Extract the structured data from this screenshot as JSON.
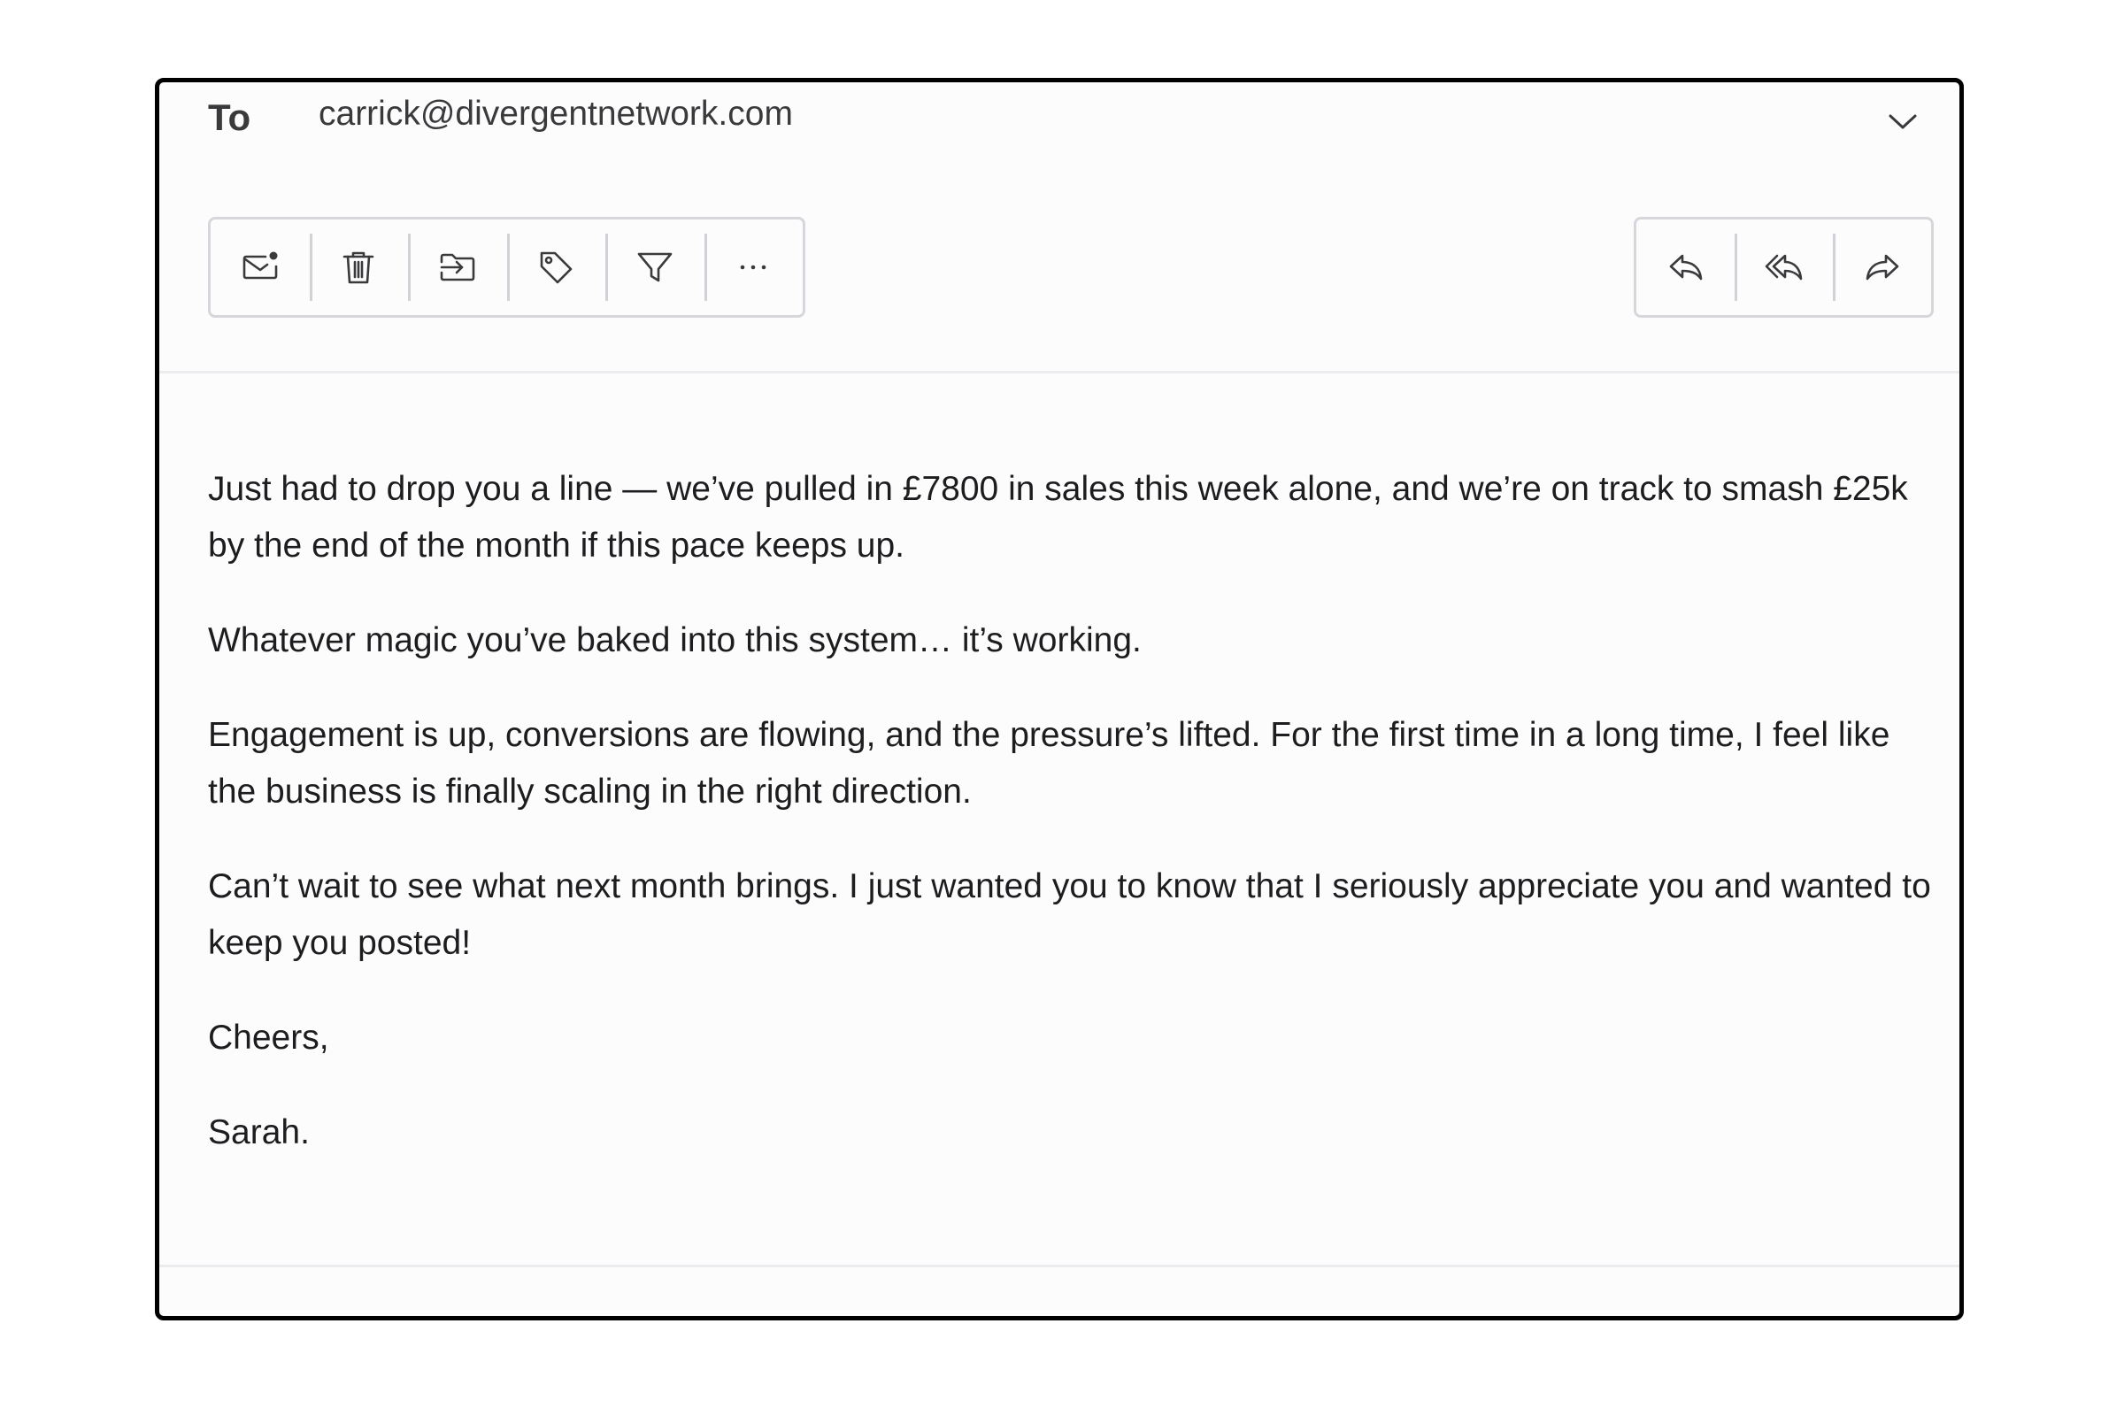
{
  "header": {
    "to_label": "To",
    "to_address": "carrick@divergentnetwork.com",
    "expand_icon": "chevron-down-icon"
  },
  "toolbar": {
    "left_actions": [
      {
        "icon": "mail-unread-icon",
        "label": "Mark as unread"
      },
      {
        "icon": "trash-icon",
        "label": "Delete"
      },
      {
        "icon": "move-to-folder-icon",
        "label": "Move"
      },
      {
        "icon": "tag-icon",
        "label": "Tag"
      },
      {
        "icon": "filter-icon",
        "label": "Filter"
      },
      {
        "icon": "more-icon",
        "label": "More"
      }
    ],
    "right_actions": [
      {
        "icon": "reply-icon",
        "label": "Reply"
      },
      {
        "icon": "reply-all-icon",
        "label": "Reply all"
      },
      {
        "icon": "forward-icon",
        "label": "Forward"
      }
    ]
  },
  "colors": {
    "border": "#000000",
    "background": "#fdfcfd",
    "text": "#1d1d1f",
    "icon": "#3a3a3c",
    "divider": "#ececef"
  },
  "body": {
    "paragraphs": [
      "Just had to drop you a line — we’ve pulled in £7800 in sales this week alone, and we’re on track to smash £25k by the end of the month if this pace keeps up.",
      "Whatever magic you’ve baked into this system… it’s working.",
      "Engagement is up, conversions are flowing, and the pressure’s lifted. For the first time in a long time, I feel like the business is finally scaling in the right direction.",
      "Can’t wait to see what next month brings. I just wanted you to know that I seriously appreciate you and wanted to keep you posted!",
      "Cheers,",
      "Sarah."
    ]
  }
}
